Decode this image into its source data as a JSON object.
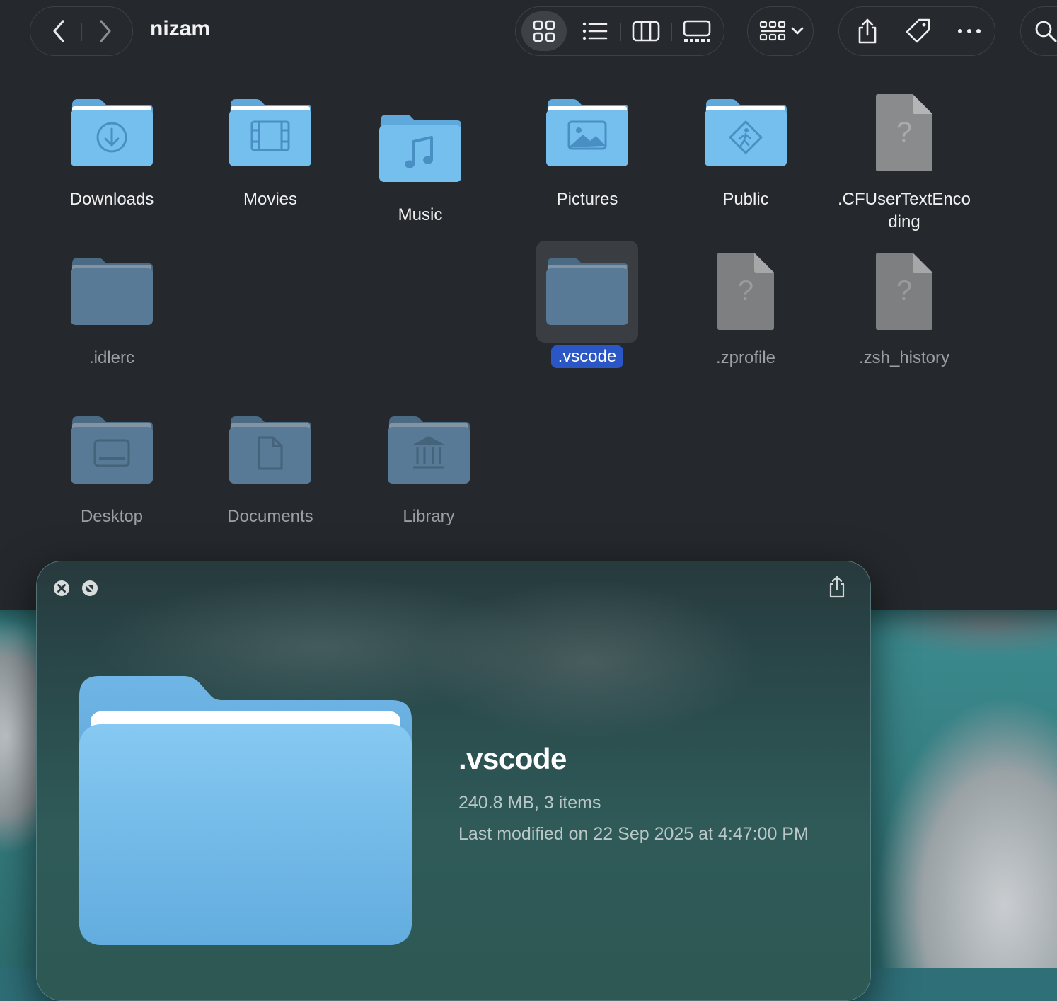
{
  "window": {
    "title": "nizam"
  },
  "toolbar": {
    "back_icon": "chevron-left-icon",
    "forward_icon": "chevron-right-icon",
    "views": [
      "icon-view",
      "list-view",
      "column-view",
      "gallery-view"
    ],
    "active_view": "icon-view",
    "group_icon": "group-by-icon",
    "share_icon": "share-icon",
    "tag_icon": "tag-icon",
    "more_icon": "more-icon",
    "search_icon": "search-icon"
  },
  "items": [
    {
      "name": "Downloads",
      "kind": "folder",
      "symbol": "download",
      "dim": false
    },
    {
      "name": "Movies",
      "kind": "folder",
      "symbol": "film",
      "dim": false
    },
    {
      "name": "Music",
      "kind": "folder",
      "symbol": "music",
      "dim": false
    },
    {
      "name": "Pictures",
      "kind": "folder",
      "symbol": "picture",
      "dim": false
    },
    {
      "name": "Public",
      "kind": "folder",
      "symbol": "public",
      "dim": false
    },
    {
      "name": ".CFUserTextEncoding",
      "label_line1": ".CFUserTextEnco",
      "label_line2": "ding",
      "kind": "file",
      "dim": false
    },
    {
      "name": ".idlerc",
      "kind": "folder",
      "symbol": "",
      "dim": true
    },
    {
      "name": ".vscode",
      "kind": "folder",
      "symbol": "",
      "dim": true,
      "selected": true
    },
    {
      "name": ".zprofile",
      "kind": "file",
      "dim": true
    },
    {
      "name": ".zsh_history",
      "kind": "file",
      "dim": true
    },
    {
      "name": "Desktop",
      "kind": "folder",
      "symbol": "desktop",
      "dim": true
    },
    {
      "name": "Documents",
      "kind": "folder",
      "symbol": "document",
      "dim": true
    },
    {
      "name": "Library",
      "kind": "folder",
      "symbol": "library",
      "dim": true
    }
  ],
  "quicklook": {
    "name": ".vscode",
    "size_info": "240.8 MB, 3 items",
    "modified": "Last modified on 22 Sep 2025 at 4:47:00 PM",
    "close_icon": "close-icon",
    "fullscreen_icon": "fullscreen-icon",
    "share_icon": "share-icon"
  },
  "colors": {
    "accent": "#2a56c6",
    "folder_blue": "#6cb6e8",
    "folder_dim": "#4e6e88",
    "window_bg": "#25282c"
  }
}
